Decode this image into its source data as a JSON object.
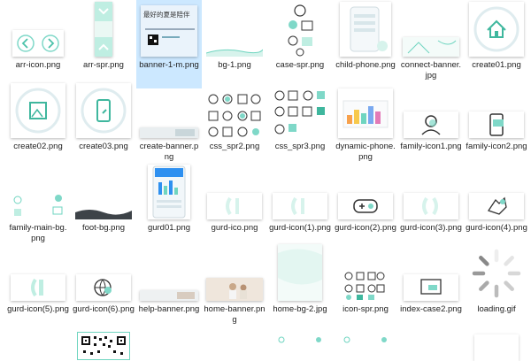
{
  "files": [
    {
      "name": "arr-icon.png",
      "icon": "arrow-icons"
    },
    {
      "name": "arr-spr.png",
      "icon": "arrow-sprite"
    },
    {
      "name": "banner-1-m.png",
      "icon": "banner-summer",
      "selected": true,
      "thumb_text": "最好的夏是陪伴"
    },
    {
      "name": "bg-1.png",
      "icon": "wave-bg"
    },
    {
      "name": "case-spr.png",
      "icon": "case-sprite"
    },
    {
      "name": "child-phone.png",
      "icon": "phone"
    },
    {
      "name": "connect-banner.jpg",
      "icon": "connect-banner"
    },
    {
      "name": "create01.png",
      "icon": "home-circle"
    },
    {
      "name": "create02.png",
      "icon": "image-circle"
    },
    {
      "name": "create03.png",
      "icon": "phone-circle"
    },
    {
      "name": "create-banner.png",
      "icon": "create-banner"
    },
    {
      "name": "css_spr2.png",
      "icon": "icon-sprite"
    },
    {
      "name": "css_spr3.png",
      "icon": "icon-sprite-2"
    },
    {
      "name": "dynamic-phone.png",
      "icon": "dynamic-chart"
    },
    {
      "name": "family-icon1.png",
      "icon": "user-icon"
    },
    {
      "name": "family-icon2.png",
      "icon": "chat-phone-icon"
    },
    {
      "name": "family-main-bg.png",
      "icon": "family-bg"
    },
    {
      "name": "foot-bg.png",
      "icon": "foot-wave"
    },
    {
      "name": "gurd01.png",
      "icon": "phone-screen"
    },
    {
      "name": "gurd-ico.png",
      "icon": "gurd-ico"
    },
    {
      "name": "gurd-icon(1).png",
      "icon": "gurd-ico"
    },
    {
      "name": "gurd-icon(2).png",
      "icon": "gamepad-icon"
    },
    {
      "name": "gurd-icon(3).png",
      "icon": "gurd-ico"
    },
    {
      "name": "gurd-icon(4).png",
      "icon": "hand-icon"
    },
    {
      "name": "gurd-icon(5).png",
      "icon": "gurd-ico"
    },
    {
      "name": "gurd-icon(6).png",
      "icon": "globe-icon"
    },
    {
      "name": "help-banner.png",
      "icon": "help-banner"
    },
    {
      "name": "home-banner.png",
      "icon": "photo-banner"
    },
    {
      "name": "home-bg-2.jpg",
      "icon": "home-bg"
    },
    {
      "name": "icon-spr.png",
      "icon": "icon-sprite-3"
    },
    {
      "name": "index-case2.png",
      "icon": "chat-box"
    },
    {
      "name": "loading.gif",
      "icon": "spinner"
    },
    {
      "name": "",
      "icon": "blank"
    },
    {
      "name": "",
      "icon": "qr-code"
    },
    {
      "name": "",
      "icon": "blank"
    },
    {
      "name": "",
      "icon": "blank"
    },
    {
      "name": "",
      "icon": "dots-sprite"
    },
    {
      "name": "",
      "icon": "dots-sprite"
    },
    {
      "name": "",
      "icon": "blank"
    },
    {
      "name": "",
      "icon": "blank-tall"
    }
  ]
}
